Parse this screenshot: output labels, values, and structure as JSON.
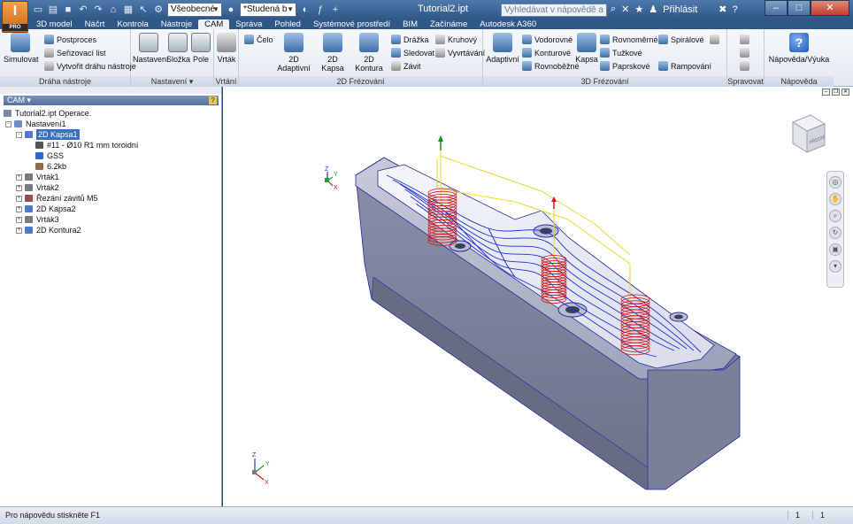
{
  "app": {
    "document_title": "Tutorial2.ipt",
    "logo_text": "I",
    "logo_sub": "PRO",
    "appearance_combo": "Všeobecné",
    "material_combo": "*Studená b",
    "help_search_placeholder": "Vyhledávat v nápovědě a příkaze",
    "signin": "Přihlásit"
  },
  "tabs": [
    "3D model",
    "Náčrt",
    "Kontrola",
    "Nástroje",
    "CAM",
    "Správa",
    "Pohled",
    "Systémové prostředí",
    "BIM",
    "Začínáme",
    "Autodesk A360"
  ],
  "active_tab": "CAM",
  "ribbon": {
    "drahanastroje": {
      "title": "Dráha nástroje",
      "simulovat": "Simulovat",
      "postproces": "Postproces",
      "serizovaci": "Seřizovací list",
      "vytvorit": "Vytvořit dráhu nástroje"
    },
    "nastaveni": {
      "title": "Nastavení",
      "nastaveni": "Nastavení",
      "slozka": "Složka",
      "pole": "Pole"
    },
    "vrtani": {
      "title": "Vrtání",
      "vrtak": "Vrták"
    },
    "frez2d": {
      "title": "2D Frézování",
      "celo": "Čelo",
      "adaptivni": "2D Adaptivní",
      "kapsa": "2D Kapsa",
      "kontura": "2D Kontura",
      "drazka": "Drážka",
      "sledovat": "Sledovat",
      "zavit": "Závit",
      "kruhovy": "Kruhový",
      "vyvrtavani": "Vyvrtávání"
    },
    "frez3d": {
      "title": "3D Frézování",
      "adaptivni": "Adaptivní",
      "vodorovne": "Vodorovné",
      "konturove": "Konturové",
      "rovnobezne": "Rovnoběžné",
      "kapsa": "Kapsa",
      "rovnomerne": "Rovnoměrné",
      "tuzkove": "Tužkové",
      "paprskove": "Paprskové",
      "spiralove": "Spirálové",
      "rampovani": "Rampování"
    },
    "spravovat": {
      "title": "Spravovat"
    },
    "napoveda": {
      "title": "Nápověda",
      "napovedavyuka": "Nápověda/Výuka"
    }
  },
  "browser": {
    "tab_label": "CAM",
    "tree": [
      {
        "label": "Tutorial2.ipt Operace.",
        "indent": 0,
        "icon": "part"
      },
      {
        "label": "Nastavení1",
        "indent": 1,
        "icon": "setup",
        "exp": "-"
      },
      {
        "label": "2D Kapsa1",
        "indent": 2,
        "icon": "pocket",
        "exp": "-",
        "selected": true
      },
      {
        "label": "#11 - Ø10 R1 mm toroidní",
        "indent": 3,
        "icon": "tool"
      },
      {
        "label": "GSS",
        "indent": 3,
        "icon": "wcs"
      },
      {
        "label": "6.2kb",
        "indent": 3,
        "icon": "nc"
      },
      {
        "label": "Vrták1",
        "indent": 2,
        "icon": "drill",
        "exp": "+"
      },
      {
        "label": "Vrták2",
        "indent": 2,
        "icon": "drill",
        "exp": "+"
      },
      {
        "label": "Řezání závitů M5",
        "indent": 2,
        "icon": "thread",
        "exp": "+"
      },
      {
        "label": "2D Kapsa2",
        "indent": 2,
        "icon": "pocket",
        "exp": "+"
      },
      {
        "label": "Vrták3",
        "indent": 2,
        "icon": "drill",
        "exp": "+"
      },
      {
        "label": "2D Kontura2",
        "indent": 2,
        "icon": "contour",
        "exp": "+"
      }
    ]
  },
  "viewcube": {
    "face_label": "PŘEDNÍ"
  },
  "status": {
    "message": "Pro nápovědu stiskněte F1",
    "cell1": "1",
    "cell2": "1"
  },
  "colors": {
    "part_face": "#8d93b0",
    "toolpath_blue": "#1f2fd6",
    "toolpath_red": "#d01a1a",
    "toolpath_yellow": "#e3dc2a"
  }
}
